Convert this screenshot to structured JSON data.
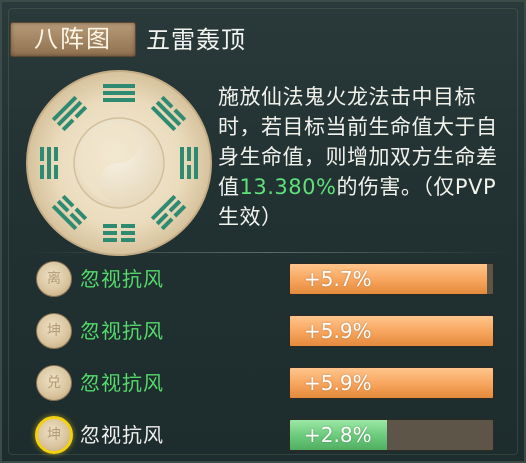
{
  "header": {
    "tag_label": "八阵图",
    "skill_name": "五雷轰顶"
  },
  "description": {
    "part1": "施放仙法鬼火龙法击中目标时，若目标当前生命值大于自身生命值，则增加双方生命差值",
    "highlight": "13.380%",
    "part2": "的伤害。（仅PVP生效）"
  },
  "rows": [
    {
      "badge": "离",
      "label": "忽视抗风",
      "value": "+5.7%",
      "fill_pct": 97,
      "fill_color": "orange",
      "active": false
    },
    {
      "badge": "坤",
      "label": "忽视抗风",
      "value": "+5.9%",
      "fill_pct": 100,
      "fill_color": "orange",
      "active": false
    },
    {
      "badge": "兑",
      "label": "忽视抗风",
      "value": "+5.9%",
      "fill_pct": 100,
      "fill_color": "orange",
      "active": false
    },
    {
      "badge": "坤",
      "label": "忽视抗风",
      "value": "+2.8%",
      "fill_pct": 48,
      "fill_color": "green",
      "active": true
    }
  ],
  "colors": {
    "highlight_green": "#5fe07a",
    "bar_orange": "#f7a45c",
    "bar_green": "#6ac97a",
    "active_ring": "#f2d10e"
  },
  "icons": {
    "bagua": "bagua-taiji-icon"
  }
}
